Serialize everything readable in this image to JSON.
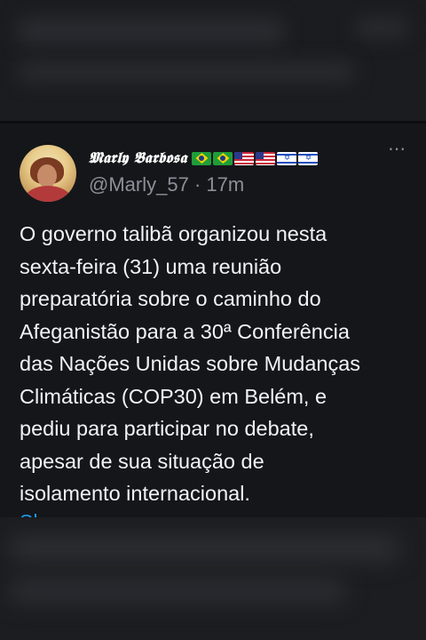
{
  "post": {
    "display_name": "𝕸𝖆𝖗𝖑𝖞 𝕭𝖆𝖗𝖇𝖔𝖘𝖆",
    "handle": "@Marly_57",
    "separator": "·",
    "time": "17m",
    "more_icon": "⋯",
    "text": "O governo talibã organizou nesta\nsexta-feira (31) uma reunião\npreparatória sobre o caminho do\nAfeganistão para a 30ª Conferência\ndas Nações Unidas sobre Mudanças\nClimáticas (COP30) em Belém, e\npediu para participar no debate,\napesar de sua situação de\nisolamento internacional.",
    "show_more": "Show more",
    "flags": [
      "brazil-flag-icon",
      "brazil-flag-icon",
      "us-flag-icon",
      "us-flag-icon",
      "israel-flag-icon",
      "israel-flag-icon"
    ]
  },
  "colors": {
    "background": "#15161a",
    "text": "#f1f3f4",
    "muted": "#8b9098",
    "link": "#1d9bf0"
  }
}
